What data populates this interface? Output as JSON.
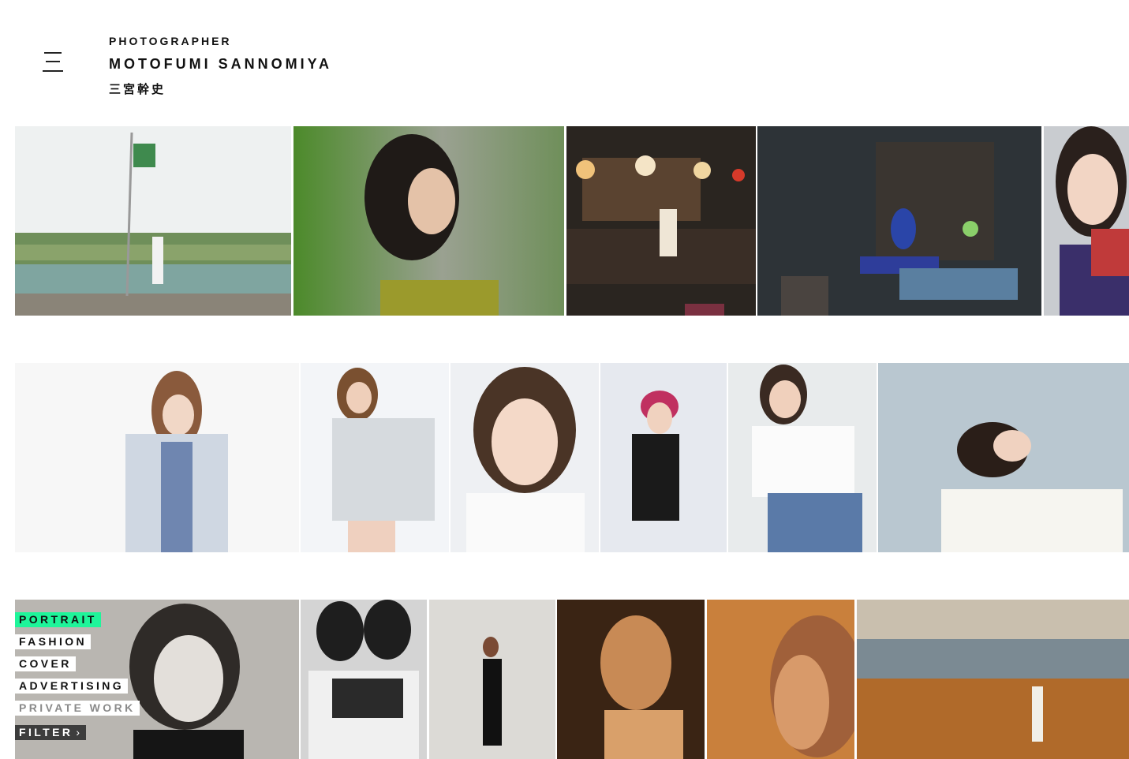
{
  "header": {
    "role": "PHOTOGRAPHER",
    "name": "MOTOFUMI SANNOMIYA",
    "name_jp": "三宮幹史"
  },
  "filter_menu": {
    "items": [
      {
        "label": "PORTRAIT",
        "state": "active"
      },
      {
        "label": "FASHION",
        "state": "normal"
      },
      {
        "label": "COVER",
        "state": "normal"
      },
      {
        "label": "ADVERTISING",
        "state": "normal"
      },
      {
        "label": "PRIVATE WORK",
        "state": "muted"
      }
    ],
    "filter_label": "FILTER",
    "filter_chevron": "›"
  },
  "gallery": {
    "rows": [
      {
        "tiles": [
          {
            "name": "photo-flag-hilltop"
          },
          {
            "name": "photo-woman-green-dress"
          },
          {
            "name": "photo-night-shopfront"
          },
          {
            "name": "photo-tea-table"
          },
          {
            "name": "photo-scarf-portrait"
          }
        ]
      },
      {
        "tiles": [
          {
            "name": "photo-knit-sweater"
          },
          {
            "name": "photo-sweatshirt"
          },
          {
            "name": "photo-short-hair-closeup"
          },
          {
            "name": "photo-flower-headband"
          },
          {
            "name": "photo-white-shirt-jeans"
          },
          {
            "name": "photo-lying-down"
          }
        ]
      },
      {
        "tiles": [
          {
            "name": "photo-monochrome-portrait"
          },
          {
            "name": "photo-two-women"
          },
          {
            "name": "photo-black-slip-dress"
          },
          {
            "name": "photo-sunlit-profile-1"
          },
          {
            "name": "photo-sunlit-profile-2"
          },
          {
            "name": "photo-coastal-meadow"
          }
        ]
      }
    ]
  },
  "colors": {
    "accent": "#1ef59a",
    "text": "#111111",
    "filter_button": "#3d3d3d"
  }
}
